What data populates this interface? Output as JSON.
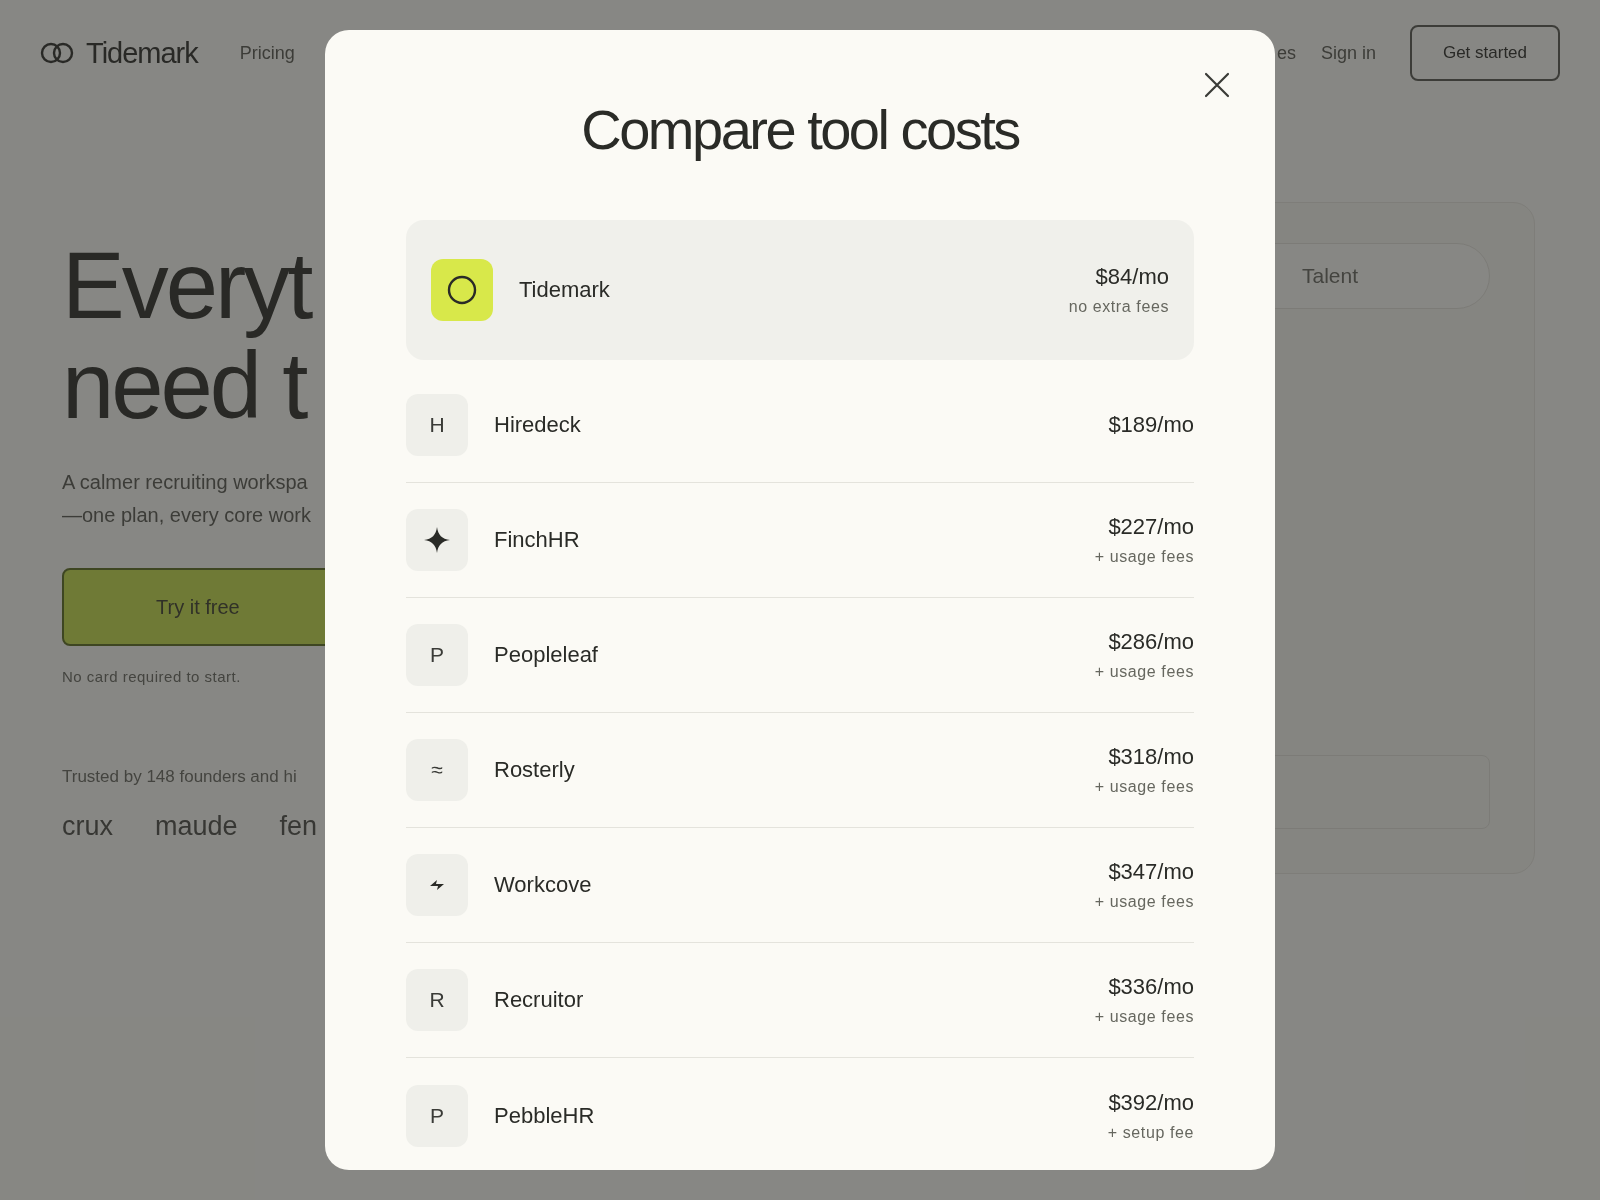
{
  "nav": {
    "brand": "Tidemark",
    "links": [
      "Pricing",
      "es",
      "Sign in"
    ],
    "cta": "Get started"
  },
  "hero": {
    "headline_lines": [
      "Everyt",
      "need t"
    ],
    "subtitle_lines": [
      "A calmer recruiting workspa",
      "—one plan, every core work"
    ],
    "button": "Try it free",
    "note": "No card required to start.",
    "trusted": "Trusted by 148 founders and hi",
    "logos": [
      "crux",
      "maude",
      "fen"
    ]
  },
  "preview_panel": {
    "tab": "Talent"
  },
  "modal": {
    "title": "Compare tool costs",
    "tools": [
      {
        "name": "Tidemark",
        "icon": {
          "kind": "ring"
        },
        "price": "$84/mo",
        "note": "no extra fees",
        "highlighted": true
      },
      {
        "name": "Hiredeck",
        "icon": {
          "kind": "glyph",
          "text": "H"
        },
        "price": "$189/mo",
        "highlighted": false
      },
      {
        "name": "FinchHR",
        "icon": {
          "kind": "sparkle"
        },
        "price": "$227/mo",
        "note": "+ usage fees",
        "highlighted": false
      },
      {
        "name": "Peopleleaf",
        "icon": {
          "kind": "glyph",
          "text": "P"
        },
        "price": "$286/mo",
        "note": "+ usage fees",
        "highlighted": false
      },
      {
        "name": "Rosterly",
        "icon": {
          "kind": "glyph",
          "text": "≈"
        },
        "price": "$318/mo",
        "note": "+ usage fees",
        "highlighted": false
      },
      {
        "name": "Workcove",
        "icon": {
          "kind": "bolt"
        },
        "price": "$347/mo",
        "note": "+ usage fees",
        "highlighted": false
      },
      {
        "name": "Recruitor",
        "icon": {
          "kind": "glyph",
          "text": "R"
        },
        "price": "$336/mo",
        "note": "+ usage fees",
        "highlighted": false
      },
      {
        "name": "PebbleHR",
        "icon": {
          "kind": "glyph",
          "text": "P"
        },
        "price": "$392/mo",
        "note": "+ setup fee",
        "highlighted": false
      }
    ]
  }
}
